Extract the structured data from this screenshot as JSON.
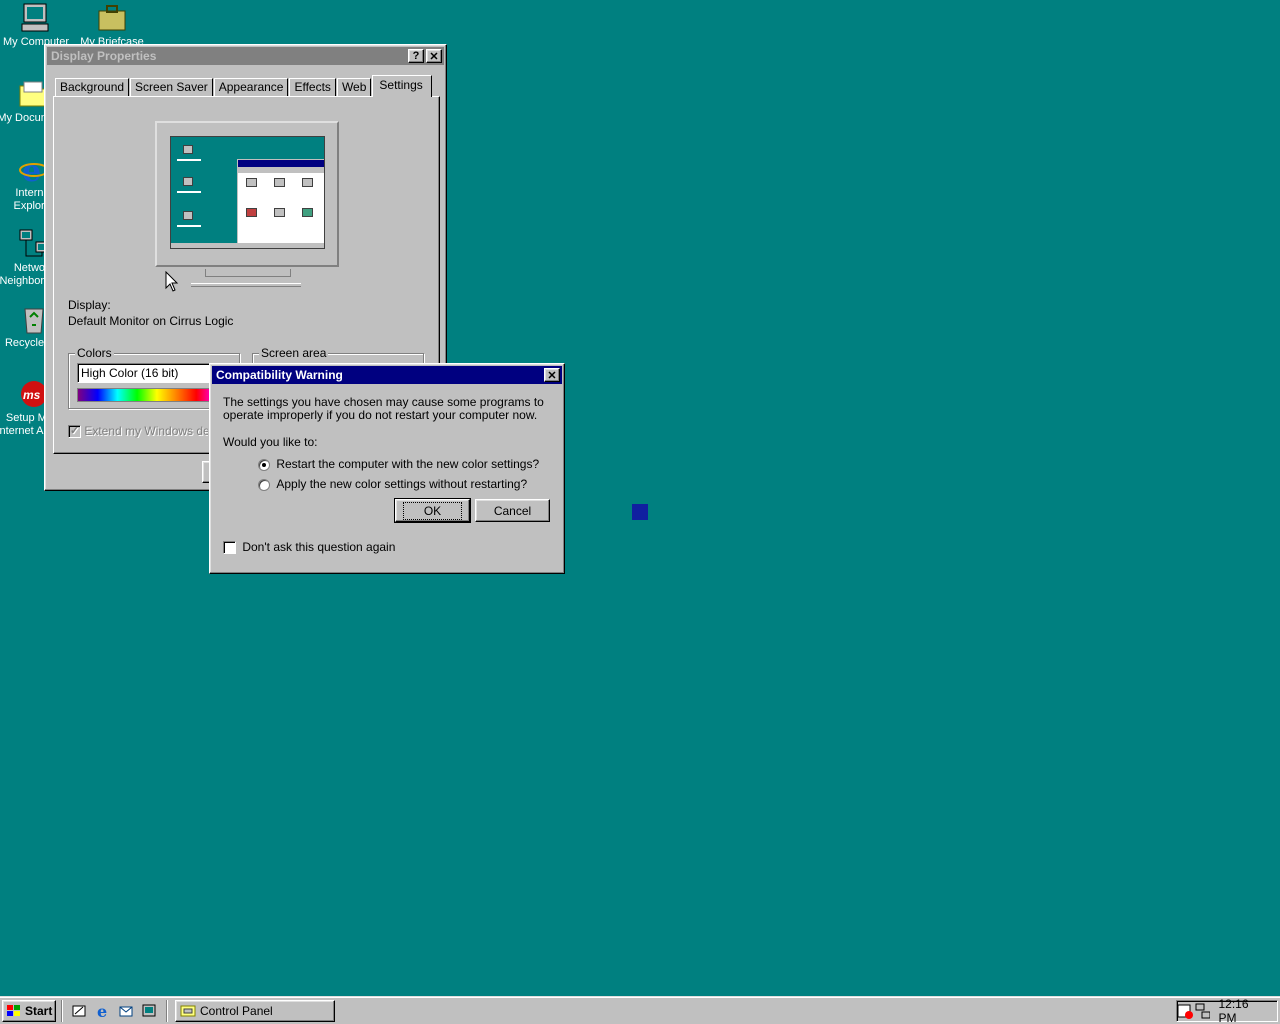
{
  "desktop": {
    "icons": [
      {
        "label": "My Computer",
        "icon": "computer-icon"
      },
      {
        "label": "My Briefcase",
        "icon": "briefcase-icon"
      },
      {
        "label": "My Documents",
        "icon": "folder-icon"
      },
      {
        "label": "Internet Explorer",
        "icon": "internet-explorer-icon"
      },
      {
        "label": "Network Neighborhood",
        "icon": "network-icon"
      },
      {
        "label": "Recycle Bin",
        "icon": "recycle-bin-icon"
      },
      {
        "label": "Setup MSN Internet Access",
        "icon": "msn-icon"
      }
    ]
  },
  "display_properties": {
    "title": "Display Properties",
    "help_btn": "?",
    "close_btn": "✕",
    "tabs": [
      "Background",
      "Screen Saver",
      "Appearance",
      "Effects",
      "Web",
      "Settings"
    ],
    "selected_tab": "Settings",
    "display_label": "Display:",
    "display_value": "Default Monitor on Cirrus Logic",
    "colors_label": "Colors",
    "colors_value": "High Color (16 bit)",
    "screen_area_label": "Screen area",
    "extend_label": "Extend my Windows desktop onto this monitor."
  },
  "compat_dialog": {
    "title": "Compatibility Warning",
    "close_btn": "✕",
    "message": "The settings you have chosen may cause some programs to operate improperly if you do not restart your computer now.",
    "question": "Would you like to:",
    "option_restart": "Restart the computer with the new color settings?",
    "option_apply": "Apply the new color settings without restarting?",
    "selected_option": "restart",
    "ok_label": "OK",
    "cancel_label": "Cancel",
    "dont_ask_label": "Don't ask this question again",
    "dont_ask_checked": false
  },
  "taskbar": {
    "start_label": "Start",
    "quick_launch": [
      "show-desktop-icon",
      "internet-explorer-icon",
      "outlook-express-icon",
      "channels-icon"
    ],
    "tasks": [
      {
        "label": "Control Panel",
        "icon": "control-panel-icon"
      }
    ],
    "clock": "12:16 PM",
    "tray_icons": [
      "scheduler-icon",
      "network-tray-icon"
    ]
  },
  "colors": {
    "desktop": "#008080",
    "title_active": "#000080",
    "title_inactive": "#808080",
    "face": "#c0c0c0"
  }
}
